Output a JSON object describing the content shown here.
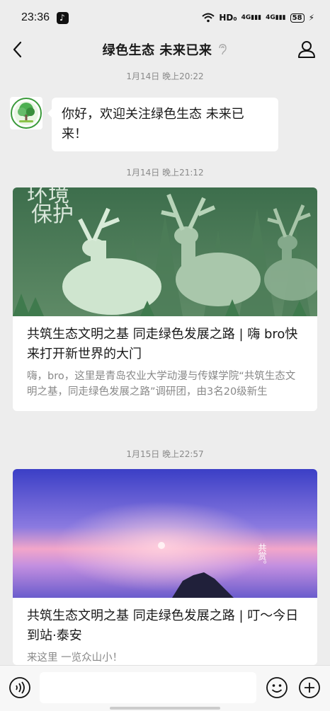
{
  "status_bar": {
    "time": "23:36",
    "network": "HD₀",
    "signal1": "4G",
    "signal2": "4G",
    "battery": "58"
  },
  "nav": {
    "title": "绿色生态 未来已来"
  },
  "messages": [
    {
      "timestamp": "1月14日 晚上20:22",
      "text": "你好，欢迎关注绿色生态 未来已来！"
    }
  ],
  "articles": [
    {
      "timestamp": "1月14日 晚上21:12",
      "image_text_1": "环境",
      "image_text_2": "保护",
      "title": "共筑生态文明之基 同走绿色发展之路 | 嗨 bro快来打开新世界的大门",
      "description": "嗨，bro，这里是青岛农业大学动漫与传媒学院“共筑生态文明之基，同走绿色发展之路”调研团，由3名20级新生"
    },
    {
      "timestamp": "1月15日 晚上22:57",
      "image_text": "共赏。",
      "title": "共筑生态文明之基 同走绿色发展之路 | 叮～今日到站·泰安",
      "description": "来这里 一览众山小！"
    }
  ],
  "colors": {
    "background": "#ededed",
    "bubble": "#ffffff",
    "timestamp": "#8a8a8a",
    "desc": "#888888"
  },
  "icons": {
    "back": "back-icon",
    "ear": "ear-icon",
    "profile": "profile-icon",
    "voice": "voice-icon",
    "emoji": "emoji-icon",
    "plus": "plus-icon"
  }
}
